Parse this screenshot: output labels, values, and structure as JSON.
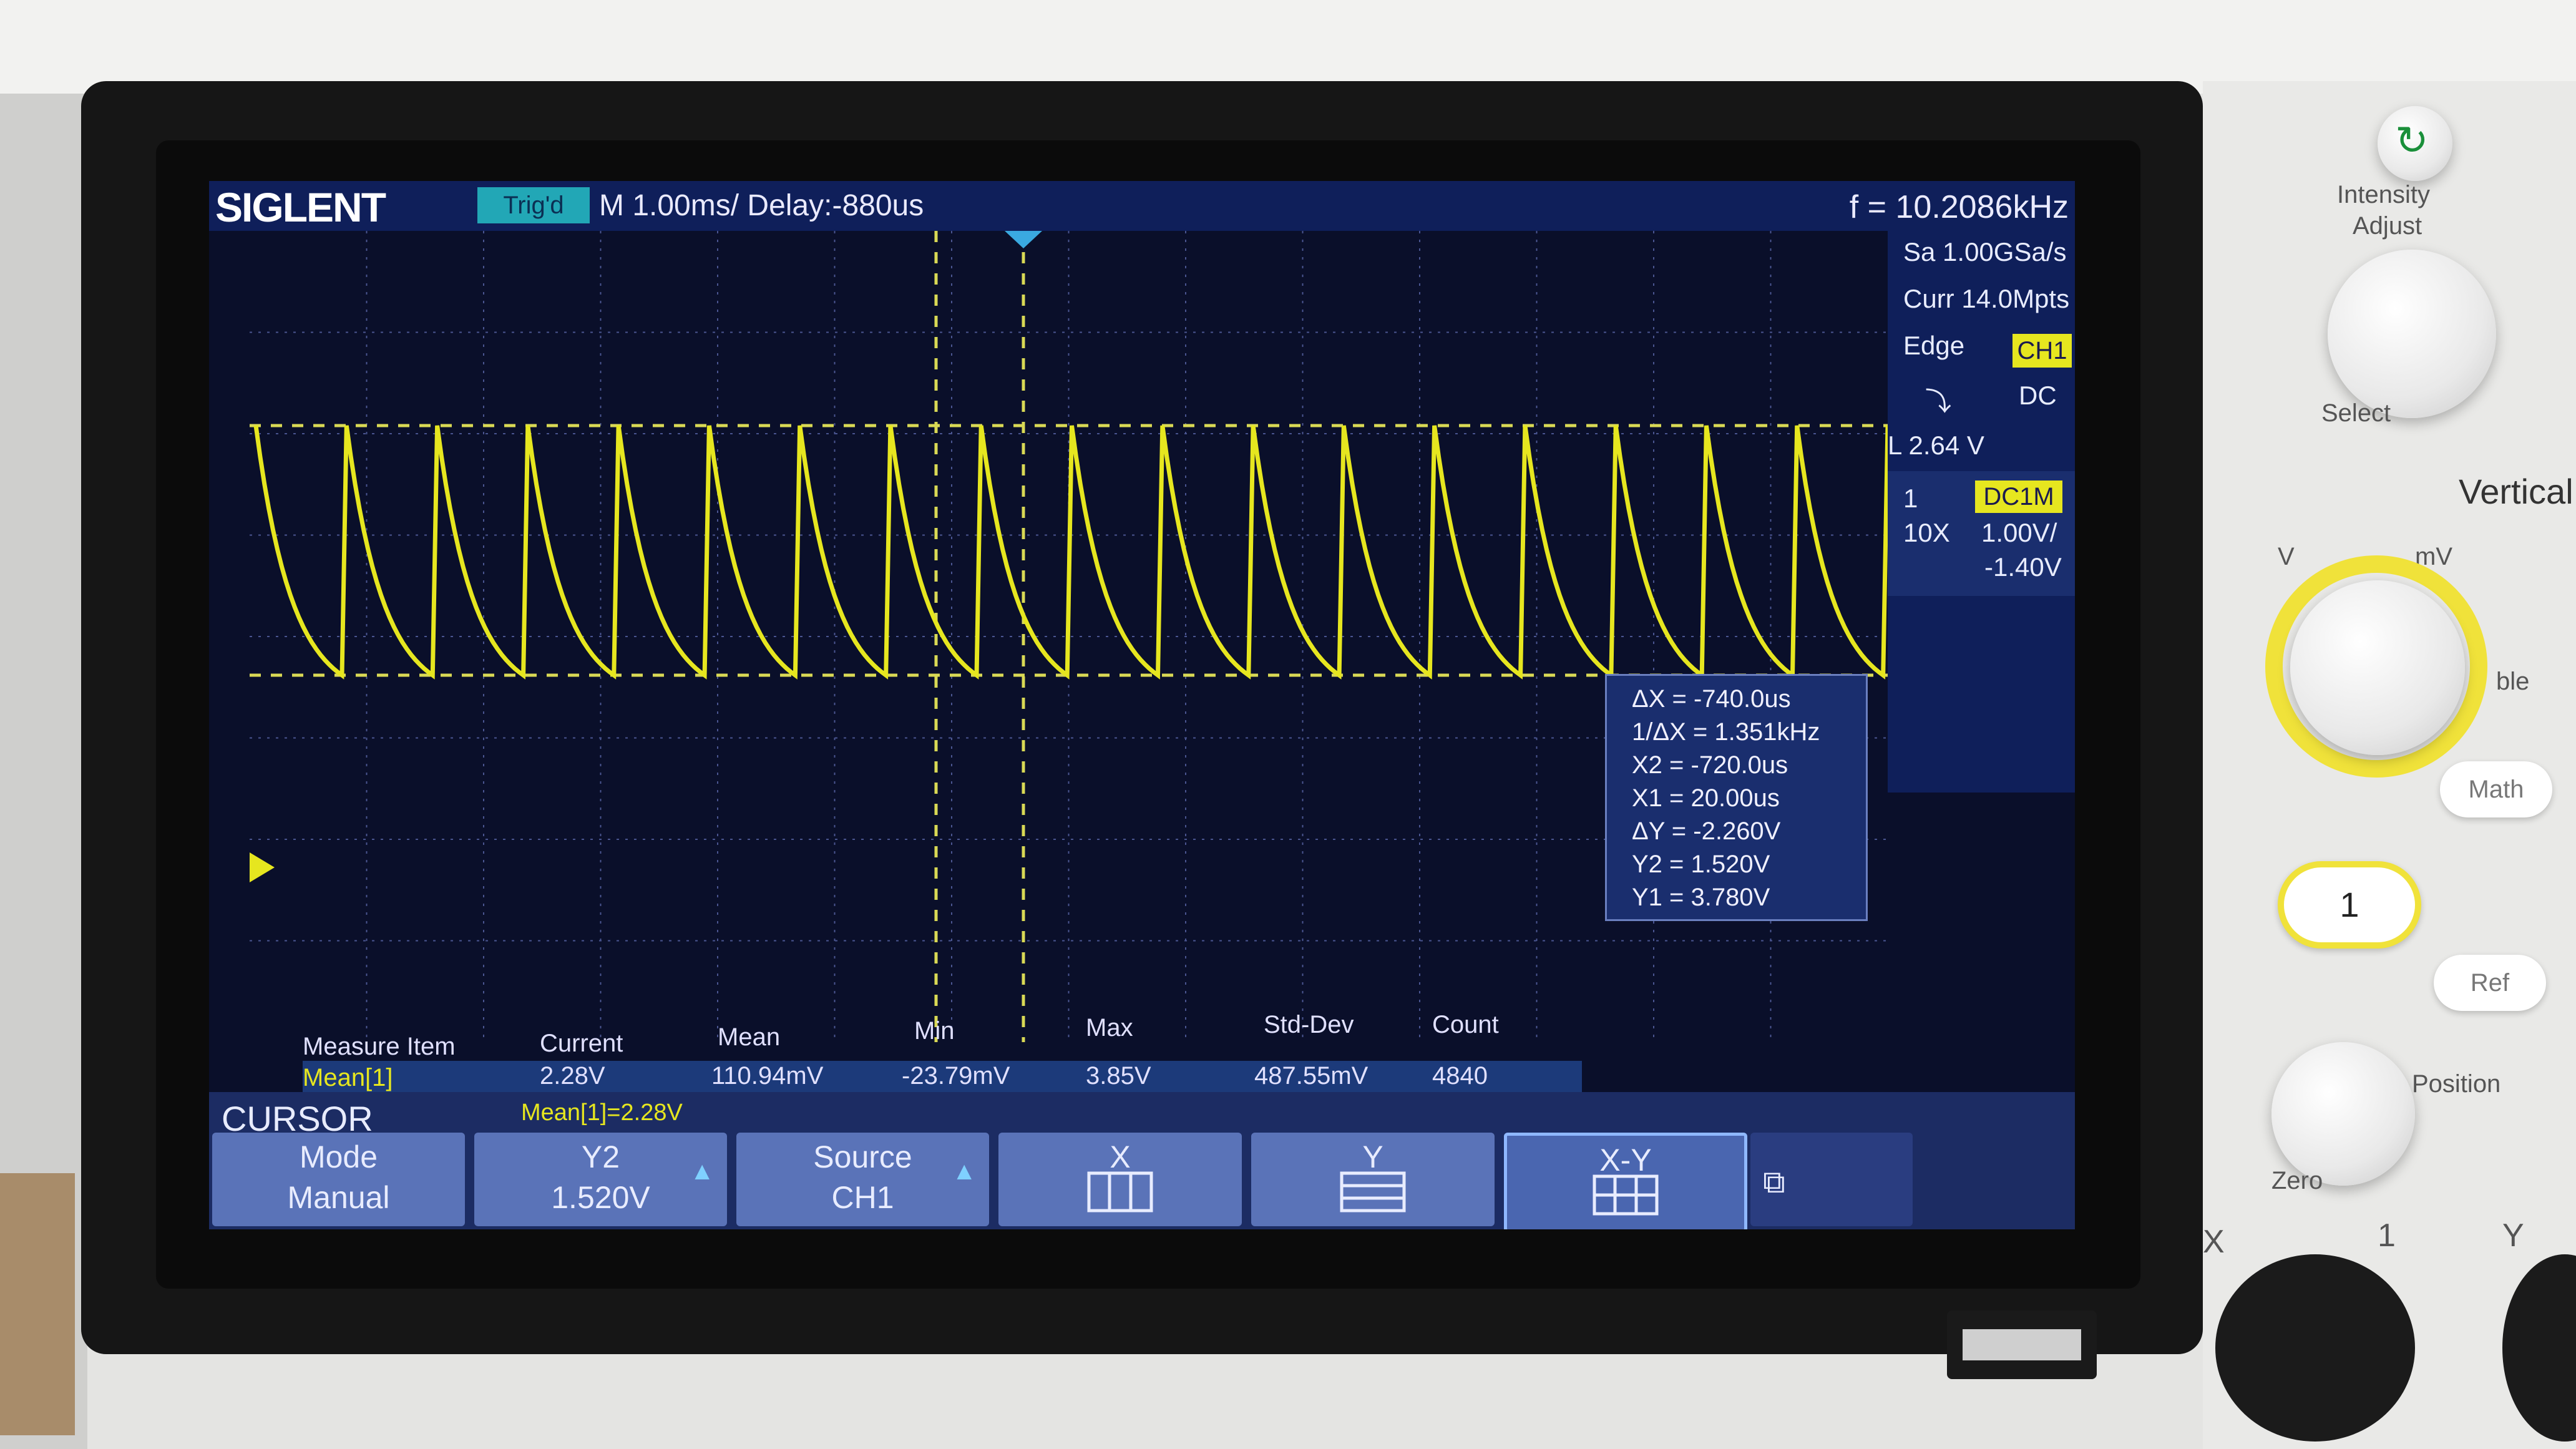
{
  "topbar": {
    "brand": "SIGLENT",
    "trigger_state": "Trig'd",
    "timebase": "M 1.00ms/ Delay:-880us",
    "frequency": "f = 10.2086kHz"
  },
  "sidebar": {
    "sample_rate": "Sa 1.00GSa/s",
    "memory_depth": "Curr 14.0Mpts",
    "trigger_type": "Edge",
    "trigger_source": "CH1",
    "trigger_coupling": "DC",
    "trigger_level": "L     2.64 V",
    "channel_number": "1",
    "channel_coupling": "DC1M",
    "probe": "10X",
    "volts_per_div": "1.00V/",
    "offset": "-1.40V"
  },
  "cursor_readout": {
    "delta_x": "ΔX = -740.0us",
    "inv_delta_x": "1/ΔX = 1.351kHz",
    "x2": "X2 = -720.0us",
    "x1": "X1 = 20.00us",
    "delta_y": "ΔY = -2.260V",
    "y2": "Y2 = 1.520V",
    "y1": "Y1 = 3.780V"
  },
  "measurements": {
    "headers": [
      "Measure Item",
      "Current",
      "Mean",
      "Min",
      "Max",
      "Std-Dev",
      "Count"
    ],
    "item": "Mean[1]",
    "current": "2.28V",
    "mean": "110.94mV",
    "min": "-23.79mV",
    "max": "3.85V",
    "std_dev": "487.55mV",
    "count": "4840"
  },
  "softkeys": {
    "menu_title": "CURSOR",
    "mean_tag": "Mean[1]=2.28V",
    "mode_label": "Mode",
    "mode_value": "Manual",
    "y2_label": "Y2",
    "y2_value": "1.520V",
    "source_label": "Source",
    "source_value": "CH1",
    "x_label": "X",
    "y_label": "Y",
    "xy_label": "X-Y"
  },
  "panel": {
    "intensity_label": "Intensity",
    "adjust_label": "Adjust",
    "select_label": "Select",
    "vertical_label": "Vertical",
    "v_label": "V",
    "mv_label": "mV",
    "scale_label": "ble",
    "math_label": "Math",
    "ch1_button": "1",
    "ref_label": "Ref",
    "position_label": "Position",
    "zero_label": "Zero",
    "x_connector": "X",
    "ch1_connector": "1",
    "y_connector": "Y"
  },
  "colors": {
    "trace": "#e6e61f",
    "screen_bg": "#0a0f2a",
    "ui_blue": "#1c2c63"
  },
  "waveform": {
    "cycles": 18,
    "high_level_v": 3.78,
    "low_level_v": 1.52
  }
}
